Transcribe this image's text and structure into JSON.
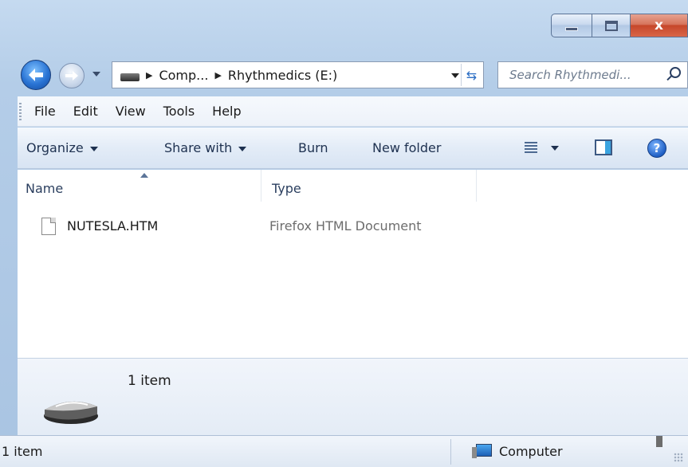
{
  "window": {
    "caption_buttons": {
      "minimize_icon": "minimize-icon",
      "maximize_icon": "maximize-icon",
      "close_label": "x"
    }
  },
  "navigation": {
    "back_icon": "back-arrow-icon",
    "forward_icon": "forward-arrow-icon",
    "address": {
      "breadcrumbs": [
        "Comp...",
        "Rhythmedics (E:)"
      ],
      "refresh_icon": "refresh-icon"
    },
    "search": {
      "placeholder": "Search Rhythmedi...",
      "icon": "search-icon"
    }
  },
  "menubar": {
    "items": [
      "File",
      "Edit",
      "View",
      "Tools",
      "Help"
    ]
  },
  "commandbar": {
    "organize": "Organize",
    "share_with": "Share with",
    "burn": "Burn",
    "new_folder": "New folder",
    "help_glyph": "?"
  },
  "filelist": {
    "columns": [
      "Name",
      "Type"
    ],
    "rows": [
      {
        "name": "NUTESLA.HTM",
        "type": "Firefox HTML Document"
      }
    ]
  },
  "details": {
    "count": "1 item"
  },
  "statusbar": {
    "left": "1 item",
    "right": "Computer"
  },
  "colors": {
    "accent": "#2a74d4",
    "close_button": "#c6472a",
    "window_frame": "#b4cde8"
  }
}
